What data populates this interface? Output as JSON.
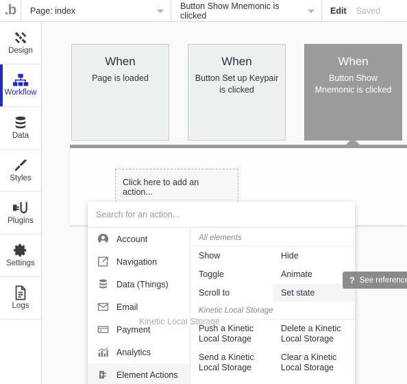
{
  "topbar": {
    "logo": "bubble-logo-icon",
    "logo_text": ".b",
    "page_select": "Page: index",
    "event_select": "Button Show Mnemonic is clicked",
    "edit_label": "Edit",
    "saved_label": "Saved"
  },
  "sidebar": {
    "items": [
      {
        "label": "Design",
        "icon": "design-icon",
        "active": false
      },
      {
        "label": "Workflow",
        "icon": "workflow-icon",
        "active": true
      },
      {
        "label": "Data",
        "icon": "database-icon",
        "active": false
      },
      {
        "label": "Styles",
        "icon": "paintbrush-icon",
        "active": false
      },
      {
        "label": "Plugins",
        "icon": "plug-icon",
        "active": false
      },
      {
        "label": "Settings",
        "icon": "gear-icon",
        "active": false
      },
      {
        "label": "Logs",
        "icon": "document-icon",
        "active": false
      }
    ]
  },
  "workflow": {
    "cards": [
      {
        "title": "When",
        "subtitle": "Page is loaded",
        "selected": false
      },
      {
        "title": "When",
        "subtitle": "Button Set up Keypair is clicked",
        "selected": false
      },
      {
        "title": "When",
        "subtitle": "Button Show Mnemonic is clicked",
        "selected": true
      }
    ],
    "add_action_label": "Click here to add an action..."
  },
  "dropdown": {
    "search_placeholder": "Search for an action...",
    "categories": [
      {
        "label": "Account",
        "icon": "user-icon",
        "selected": false
      },
      {
        "label": "Navigation",
        "icon": "share-icon",
        "selected": false
      },
      {
        "label": "Data (Things)",
        "icon": "database-icon",
        "selected": false
      },
      {
        "label": "Email",
        "icon": "envelope-icon",
        "selected": false
      },
      {
        "label": "Payment",
        "icon": "credit-card-icon",
        "selected": false
      },
      {
        "label": "Analytics",
        "icon": "bar-chart-icon",
        "selected": false
      },
      {
        "label": "Element Actions",
        "icon": "plug-bolt-icon",
        "selected": true
      }
    ],
    "sections": [
      {
        "header": "All elements",
        "rows": [
          {
            "left": "Show",
            "right": "Hide",
            "left_hl": false,
            "right_hl": false
          },
          {
            "left": "Toggle",
            "right": "Animate",
            "left_hl": false,
            "right_hl": false
          },
          {
            "left": "Scroll to",
            "right": "Set state",
            "left_hl": false,
            "right_hl": true
          }
        ]
      },
      {
        "header": "Kinetic Local Storage",
        "rows": [
          {
            "left": "Push a Kinetic Local Storage",
            "right": "Delete a Kinetic Local Storage",
            "left_hl": false,
            "right_hl": false
          },
          {
            "left": "Send a Kinetic Local Storage",
            "right": "Clear a Kinetic Local Storage",
            "left_hl": false,
            "right_hl": false
          }
        ]
      }
    ]
  },
  "tooltip": {
    "icon": "question-mark-icon",
    "mark": "?",
    "label": "See reference"
  },
  "drag_ghost": {
    "label": "Kinetic Local Storage"
  },
  "colors": {
    "accent": "#1f28cd",
    "selected_card": "#9b9b9b",
    "tooltip_bg": "#8b8b8b",
    "canvas": "#fafafa"
  }
}
